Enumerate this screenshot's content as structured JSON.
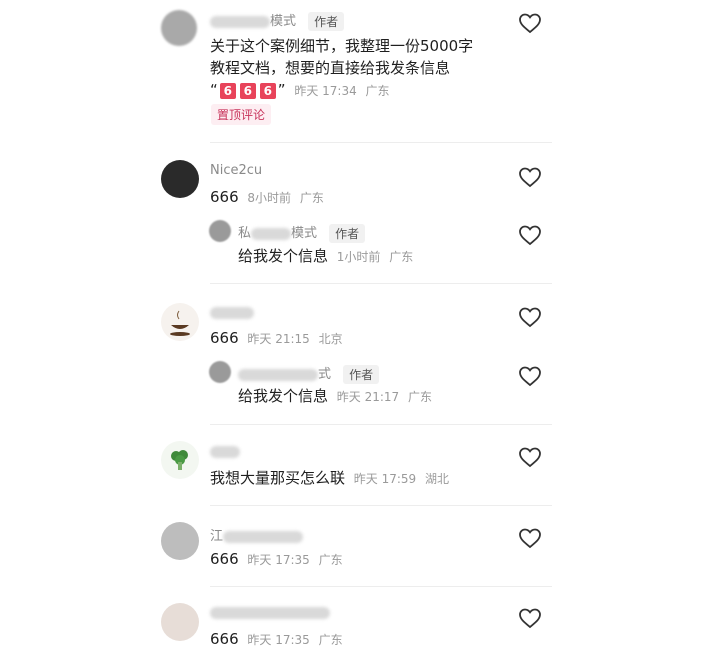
{
  "comments": [
    {
      "name_visible": "模式",
      "author_tag": "作者",
      "text_line1": "关于这个案例细节，我整理一份5000字",
      "text_line2": "教程文档，想要的直接给我发条信息",
      "text_line3_prefix": "“",
      "emoji": [
        "6",
        "6",
        "6"
      ],
      "text_line3_suffix": "”",
      "time": "昨天 17:34",
      "region": "广东",
      "pinned_label": "置顶评论"
    },
    {
      "name": "Nice2cu",
      "text": "666",
      "time": "8小时前",
      "region": "广东",
      "reply": {
        "name_prefix": "私",
        "name_suffix": "模式",
        "author_tag": "作者",
        "text": "给我发个信息",
        "time": "1小时前",
        "region": "广东"
      }
    },
    {
      "text": "666",
      "time": "昨天 21:15",
      "region": "北京",
      "reply": {
        "name_suffix": "式",
        "author_tag": "作者",
        "text": "给我发个信息",
        "time": "昨天 21:17",
        "region": "广东"
      }
    },
    {
      "text": "我想大量那买怎么联",
      "time": "昨天 17:59",
      "region": "湖北"
    },
    {
      "name_prefix": "江",
      "text": "666",
      "time": "昨天 17:35",
      "region": "广东"
    },
    {
      "text": "666",
      "time": "昨天 17:35",
      "region": "广东"
    }
  ],
  "colors": {
    "pin": "#c8325a",
    "meta": "#9a9a9a",
    "heart_stroke": "#333333"
  },
  "icons": {
    "like": "heart-outline-icon"
  }
}
